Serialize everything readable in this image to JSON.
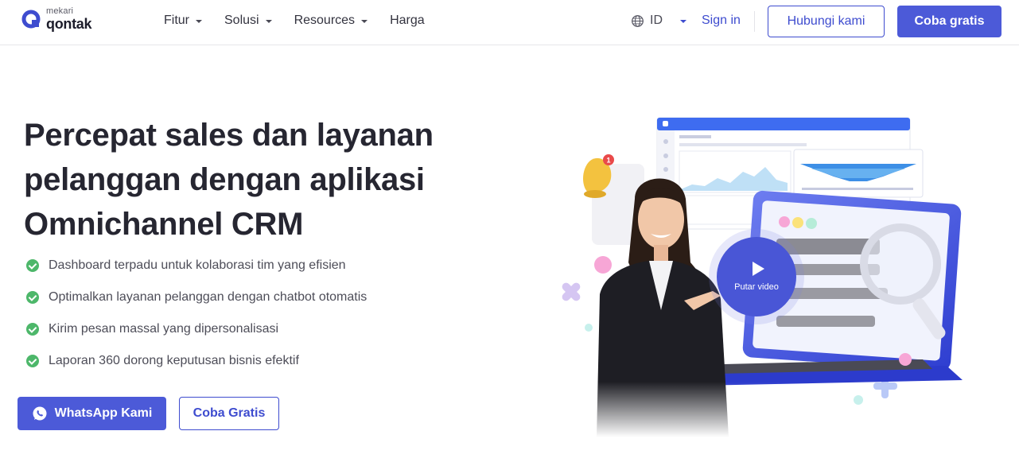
{
  "brand": {
    "sub": "mekari",
    "name": "qontak"
  },
  "nav": {
    "items": [
      {
        "label": "Fitur",
        "dropdown": true
      },
      {
        "label": "Solusi",
        "dropdown": true
      },
      {
        "label": "Resources",
        "dropdown": true
      },
      {
        "label": "Harga",
        "dropdown": false
      }
    ]
  },
  "header": {
    "language": "ID",
    "sign_in": "Sign in",
    "contact_button": "Hubungi kami",
    "trial_button": "Coba gratis"
  },
  "hero": {
    "title_lines": [
      "Percepat sales dan layanan",
      "pelanggan dengan aplikasi",
      "Omnichannel CRM"
    ],
    "features": [
      "Dashboard terpadu untuk kolaborasi tim yang efisien",
      "Optimalkan layanan pelanggan dengan chatbot otomatis",
      "Kirim pesan massal yang dipersonalisasi",
      "Laporan 360 dorong keputusan bisnis efektif"
    ],
    "whatsapp_button": "WhatsApp Kami",
    "trial_button": "Coba Gratis"
  },
  "video": {
    "play_label": "Putar video"
  },
  "colors": {
    "primary": "#4c5ad8",
    "check": "#4db76a",
    "text": "#262631"
  },
  "icons": [
    "qontak-logo-icon",
    "chevron-down-icon",
    "globe-icon",
    "check-circle-icon",
    "whatsapp-icon",
    "play-icon",
    "bell-icon",
    "magnifier-icon"
  ]
}
